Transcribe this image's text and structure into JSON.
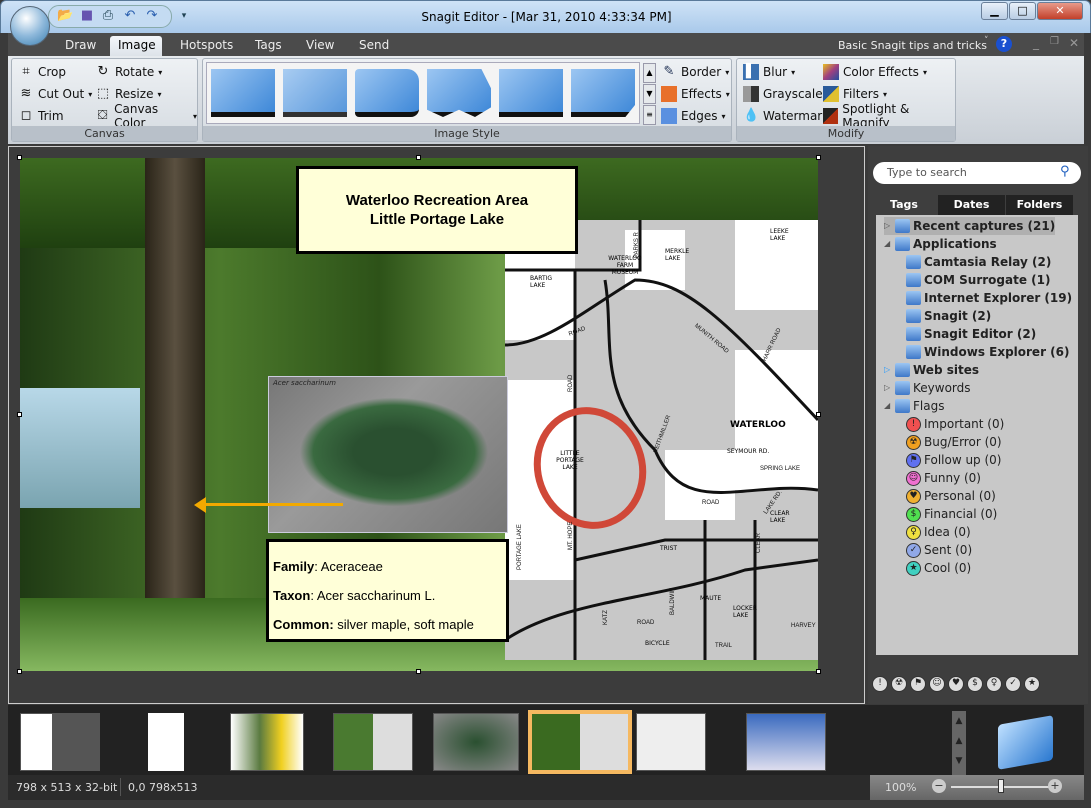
{
  "window": {
    "title": "Snagit Editor - [Mar 31, 2010 4:33:34 PM]",
    "minimize": "▁",
    "maximize": "□",
    "close": "✕"
  },
  "quick_access": [
    "open-icon",
    "save-icon",
    "print-icon",
    "undo-icon",
    "redo-icon",
    "customize-icon"
  ],
  "tabs": [
    {
      "label": "Draw"
    },
    {
      "label": "Image",
      "selected": true
    },
    {
      "label": "Hotspots"
    },
    {
      "label": "Tags"
    },
    {
      "label": "View"
    },
    {
      "label": "Send"
    }
  ],
  "help": {
    "label": "Basic Snagit tips and tricks"
  },
  "ribbon": {
    "canvas": {
      "label": "Canvas",
      "buttons": [
        "Crop",
        "Cut Out",
        "Trim",
        "Rotate",
        "Resize",
        "Canvas Color"
      ]
    },
    "image_style": {
      "label": "Image Style",
      "buttons": [
        "Border",
        "Effects",
        "Edges"
      ]
    },
    "modify": {
      "label": "Modify",
      "buttons": [
        "Blur",
        "Grayscale",
        "Watermark",
        "Color Effects",
        "Filters",
        "Spotlight & Magnify"
      ]
    }
  },
  "canvas": {
    "title_callout": [
      "Waterloo Recreation Area",
      "Little Portage Lake"
    ],
    "leaf_caption": "Acer saccharinum",
    "info": [
      {
        "key": "Family",
        "value": ": Aceraceae"
      },
      {
        "key": "Taxon",
        "value": ": Acer saccharinum L."
      },
      {
        "key": "Common:",
        "value": " silver maple, soft maple"
      }
    ],
    "map_labels": [
      "PARKS R",
      "LEEKE LAKE",
      "MERKLE LAKE",
      "BARTIG LAKE",
      "WATERLOO FARM MUSEUM",
      "ROAD",
      "MUNITH ROAD",
      "HARR ROAD",
      "ROAD",
      "LITTLE PORTAGE LAKE",
      "REITHMILLER",
      "WATERLOO",
      "SEYMOUR RD.",
      "SPRING LAKE",
      "TRIST",
      "ROAD",
      "LAKE RD.",
      "CLEAR LAKE",
      "MT. HOPE",
      "PORTAGE LAKE",
      "CLEAR",
      "BALDWIN",
      "MAUTE",
      "LOCKER LAKE",
      "KATZ",
      "ROAD",
      "TRAIL",
      "BICYCLE",
      "HARVEY"
    ],
    "accent": "#f2a900"
  },
  "panel": {
    "search_placeholder": "Type to search",
    "tabs": [
      "Tags",
      "Dates",
      "Folders"
    ],
    "tree": [
      {
        "label": "Recent captures (21)",
        "bold": true,
        "indent": 0,
        "arrow": "▷"
      },
      {
        "label": "Applications",
        "bold": true,
        "indent": 0,
        "arrow": "◢"
      },
      {
        "label": "Camtasia Relay (2)",
        "bold": true,
        "indent": 1
      },
      {
        "label": "COM Surrogate (1)",
        "bold": true,
        "indent": 1
      },
      {
        "label": "Internet Explorer (19)",
        "bold": true,
        "indent": 1
      },
      {
        "label": "Snagit (2)",
        "bold": true,
        "indent": 1
      },
      {
        "label": "Snagit Editor (2)",
        "bold": true,
        "indent": 1
      },
      {
        "label": "Windows Explorer (6)",
        "bold": true,
        "indent": 1
      },
      {
        "label": "Web sites",
        "bold": true,
        "indent": 0,
        "arrow": "▷"
      },
      {
        "label": "Keywords",
        "bold": false,
        "indent": 0,
        "arrow": "▷"
      },
      {
        "label": "Flags",
        "bold": false,
        "indent": 0,
        "arrow": "◢"
      }
    ],
    "flags": [
      {
        "label": "Important (0)",
        "color": "#f05050",
        "glyph": "!"
      },
      {
        "label": "Bug/Error (0)",
        "color": "#f0a020",
        "glyph": "☢"
      },
      {
        "label": "Follow up (0)",
        "color": "#6070f0",
        "glyph": "⚑"
      },
      {
        "label": "Funny (0)",
        "color": "#f070d0",
        "glyph": "☺"
      },
      {
        "label": "Personal (0)",
        "color": "#f0b030",
        "glyph": "♥"
      },
      {
        "label": "Financial (0)",
        "color": "#50e050",
        "glyph": "$"
      },
      {
        "label": "Idea (0)",
        "color": "#f0e040",
        "glyph": "♀"
      },
      {
        "label": "Sent (0)",
        "color": "#90a8e8",
        "glyph": "✓"
      },
      {
        "label": "Cool (0)",
        "color": "#40d0c0",
        "glyph": "★"
      }
    ]
  },
  "status": {
    "size": "798 x 513 x 32-bit",
    "selection": "0,0  798x513",
    "zoom": "100%",
    "zoom_level": 0.5
  }
}
